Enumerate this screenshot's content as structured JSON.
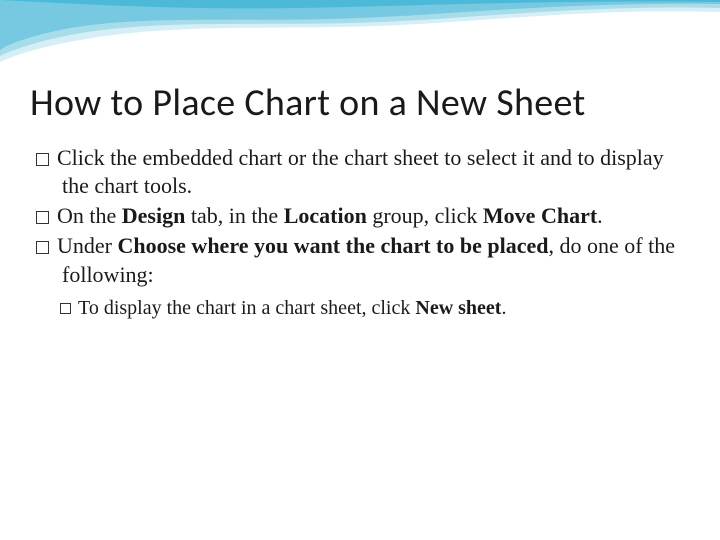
{
  "slide": {
    "title": "How to Place Chart on a New Sheet",
    "bullets": [
      {
        "level": 1,
        "runs": [
          {
            "t": "Click the embedded chart or the chart sheet to select it and to display the chart tools.",
            "b": false
          }
        ]
      },
      {
        "level": 1,
        "runs": [
          {
            "t": "On the ",
            "b": false
          },
          {
            "t": "Design",
            "b": true
          },
          {
            "t": " tab, in the ",
            "b": false
          },
          {
            "t": "Location",
            "b": true
          },
          {
            "t": " group, click ",
            "b": false
          },
          {
            "t": "Move Chart",
            "b": true
          },
          {
            "t": ".",
            "b": false
          }
        ]
      },
      {
        "level": 1,
        "runs": [
          {
            "t": "Under ",
            "b": false
          },
          {
            "t": "Choose where you want the chart to be placed",
            "b": true
          },
          {
            "t": ", do one of the following:",
            "b": false
          }
        ]
      },
      {
        "level": 2,
        "runs": [
          {
            "t": "To display the chart in a chart sheet, click ",
            "b": false
          },
          {
            "t": "New sheet",
            "b": true
          },
          {
            "t": ".",
            "b": false
          }
        ]
      }
    ]
  },
  "theme": {
    "wave_primary": "#4db9d8",
    "wave_secondary": "#a8dce8",
    "wave_light": "#d6eef5"
  }
}
